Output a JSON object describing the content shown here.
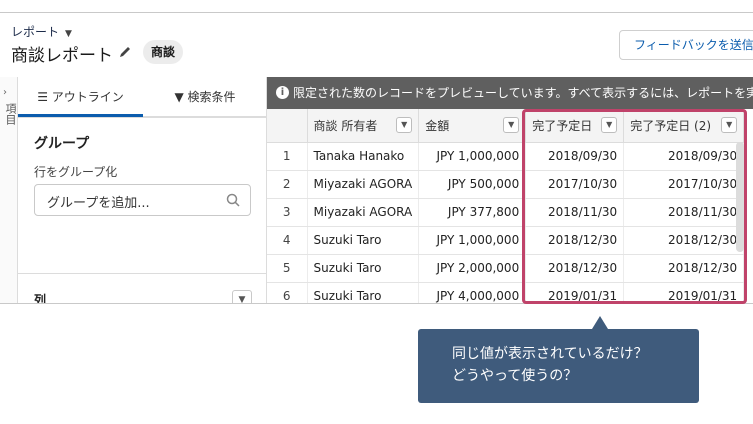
{
  "header": {
    "breadcrumb": "レポート",
    "title": "商談レポート",
    "badge": "商談",
    "feedback_button": "フィードバックを送信"
  },
  "rail": {
    "label": "項目"
  },
  "panel": {
    "tabs": [
      {
        "label": "アウトライン"
      },
      {
        "label": "検索条件"
      }
    ],
    "group_title": "グループ",
    "group_sub": "行をグループ化",
    "group_placeholder": "グループを追加...",
    "columns_title": "列"
  },
  "preview": {
    "banner": "限定された数のレコードをプレビューしています。すべて表示するには、レポートを実行してください。",
    "columns": [
      "",
      "商談 所有者",
      "金額",
      "完了予定日",
      "完了予定日 (2)"
    ],
    "rows": [
      [
        "1",
        "Tanaka Hanako",
        "JPY 1,000,000",
        "2018/09/30",
        "2018/09/30"
      ],
      [
        "2",
        "Miyazaki AGORA",
        "JPY 500,000",
        "2017/10/30",
        "2017/10/30"
      ],
      [
        "3",
        "Miyazaki AGORA",
        "JPY 377,800",
        "2018/11/30",
        "2018/11/30"
      ],
      [
        "4",
        "Suzuki Taro",
        "JPY 1,000,000",
        "2018/12/30",
        "2018/12/30"
      ],
      [
        "5",
        "Suzuki Taro",
        "JPY 2,000,000",
        "2018/12/30",
        "2018/12/30"
      ],
      [
        "6",
        "Suzuki Taro",
        "JPY 4,000,000",
        "2019/01/31",
        "2019/01/31"
      ]
    ]
  },
  "callout": {
    "line1": "同じ値が表示されているだけ？",
    "line2": "どうやって使うの？"
  },
  "colors": {
    "highlight": "#c0436a",
    "callout_bg": "#3f5b7c",
    "accent": "#0b5cad",
    "banner_bg": "#5f5f5f"
  }
}
